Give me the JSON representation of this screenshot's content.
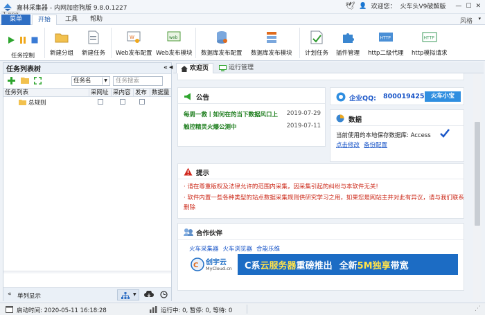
{
  "window": {
    "title": "嘉林采集器 - 内网加密狗版 9.8.0.1227",
    "file_tag": "1.png",
    "welcome": "欢迎您：",
    "user": "火车头V9破解版",
    "skin": "风格"
  },
  "menu": {
    "main": "菜单",
    "tabs": [
      "开始",
      "工具",
      "帮助"
    ]
  },
  "ribbon": {
    "task_control": "任务控制",
    "buttons": [
      "新建分组",
      "新建任务",
      "Web发布配置",
      "Web发布模块",
      "数据库发布配置",
      "数据库发布模块",
      "计划任务",
      "插件管理",
      "http二级代理",
      "http模拟请求"
    ]
  },
  "left_panel": {
    "title": "任务列表树",
    "collapse": "«",
    "select_value": "任务名",
    "search_placeholder": "任务搜索",
    "columns": [
      "任务列表",
      "采网址",
      "采内容",
      "发布",
      "数据量"
    ],
    "tree_item": "总规则",
    "footer_label": "单列显示"
  },
  "doc_tabs": [
    "欢迎页",
    "运行管理"
  ],
  "notice_card": {
    "title": "公告",
    "items": [
      {
        "text": "每周一救丨如何在的当下数据风口上",
        "date": "2019-07-29"
      },
      {
        "text": "触控精灵火爆公测中",
        "date": "2019-07-11"
      }
    ]
  },
  "qq_card": {
    "label": "企业QQ:",
    "number": "800019425",
    "button": "火车小宝"
  },
  "data_card": {
    "title": "数据",
    "db_text": "当前使用的本地保存数据库: Access",
    "link1": "点击修改",
    "link2": "备份配置"
  },
  "tips_card": {
    "title": "提示",
    "lines": [
      "· 请在尊重版权及法律允许的范围内采集，因采集引起的纠纷与本软件无关!",
      "· 软件内置一些各种类型的站点数据采集规则供研究学习之用，如果您是网站主并对此有异议，请与我们联系删除"
    ]
  },
  "partner_card": {
    "title": "合作伙伴",
    "links": [
      "火车采集器",
      "火车浏览器",
      "合能乐维"
    ],
    "banner_brand": "创宇云",
    "banner_sub": "MyCloud.cn",
    "banner_text1": "C系",
    "banner_text2": "云服务器",
    "banner_text3": "重磅推出",
    "banner_text4": "全新",
    "banner_text5": "5M独享",
    "banner_text6": "带宽"
  },
  "status": {
    "start_time": "启动时间: 2020-05-11 16:18:28",
    "running": "运行中: 0, 暂停: 0, 等待: 0"
  },
  "colors": {
    "accent": "#2f6fc4",
    "green": "#1e7e1e",
    "red": "#cc2a1a",
    "link": "#1a56c8",
    "banner_bg": "#1c6cc4"
  }
}
